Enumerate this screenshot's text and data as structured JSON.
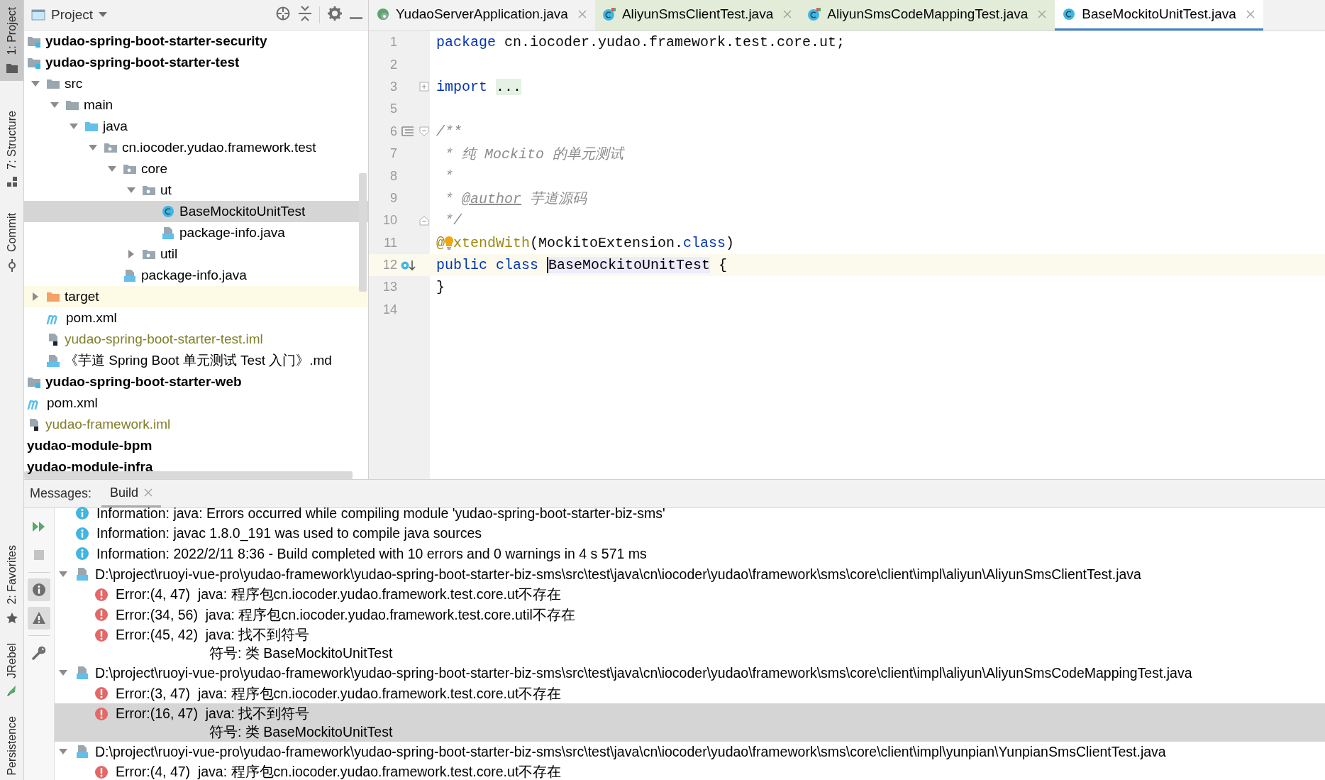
{
  "tool_strip": {
    "top": [
      {
        "label": "1: Project",
        "kind": "folder",
        "selected": true
      },
      {
        "label": "7: Structure",
        "kind": "structure",
        "selected": false
      },
      {
        "label": "Commit",
        "kind": "commit",
        "selected": false
      }
    ],
    "bottom": [
      {
        "label": "2: Favorites",
        "kind": "star",
        "selected": false
      },
      {
        "label": "JRebel",
        "kind": "jrebel",
        "selected": false
      },
      {
        "label": "Persistence",
        "kind": "none",
        "selected": false
      }
    ]
  },
  "project": {
    "title": "Project",
    "tree": [
      {
        "label": "yudao-spring-boot-starter-security",
        "kind": "module",
        "selected": false
      },
      {
        "label": "yudao-spring-boot-starter-test",
        "kind": "module",
        "selected": false,
        "children": [
          {
            "label": "src",
            "kind": "folder",
            "selected": false,
            "expanded": true,
            "children": [
              {
                "label": "main",
                "kind": "folder",
                "selected": false,
                "expanded": true,
                "children": [
                  {
                    "label": "java",
                    "kind": "source-folder",
                    "selected": false,
                    "expanded": true,
                    "children": [
                      {
                        "label": "cn.iocoder.yudao.framework.test",
                        "kind": "package",
                        "selected": false,
                        "expanded": true,
                        "children": [
                          {
                            "label": "core",
                            "kind": "package",
                            "selected": false,
                            "expanded": true,
                            "children": [
                              {
                                "label": "ut",
                                "kind": "package",
                                "selected": false,
                                "expanded": true,
                                "children": [
                                  {
                                    "label": "BaseMockitoUnitTest",
                                    "kind": "class",
                                    "selected": true
                                  },
                                  {
                                    "label": "package-info.java",
                                    "kind": "java-file",
                                    "selected": false
                                  }
                                ]
                              },
                              {
                                "label": "util",
                                "kind": "package",
                                "selected": false,
                                "expanded": false
                              }
                            ]
                          },
                          {
                            "label": "package-info.java",
                            "kind": "java-file",
                            "selected": false
                          }
                        ]
                      }
                    ]
                  }
                ]
              }
            ]
          },
          {
            "label": "target",
            "kind": "excluded-folder",
            "selected": false,
            "expanded": false
          },
          {
            "label": "pom.xml",
            "kind": "maven",
            "selected": false
          },
          {
            "label": "yudao-spring-boot-starter-test.iml",
            "kind": "iml",
            "selected": false
          },
          {
            "label": "《芋道 Spring Boot 单元测试 Test 入门》.md",
            "kind": "markdown",
            "selected": false
          }
        ]
      },
      {
        "label": "yudao-spring-boot-starter-web",
        "kind": "module",
        "selected": false
      },
      {
        "label": "pom.xml",
        "kind": "maven",
        "selected": false
      },
      {
        "label": "yudao-framework.iml",
        "kind": "iml",
        "selected": false
      },
      {
        "label": "yudao-module-bpm",
        "kind": "group",
        "selected": false
      },
      {
        "label": "yudao-module-infra",
        "kind": "group",
        "selected": false
      }
    ]
  },
  "editor": {
    "tabs": [
      {
        "label": "YudaoServerApplication.java",
        "kind": "spring-app",
        "selected": false,
        "test_scope": false
      },
      {
        "label": "AliyunSmsClientTest.java",
        "kind": "test-class",
        "selected": false,
        "test_scope": true
      },
      {
        "label": "AliyunSmsCodeMappingTest.java",
        "kind": "test-class",
        "selected": false,
        "test_scope": true
      },
      {
        "label": "BaseMockitoUnitTest.java",
        "kind": "class",
        "selected": true,
        "test_scope": false
      }
    ],
    "lines": [
      {
        "number": "1",
        "current": false,
        "tokens": [
          {
            "text": "package",
            "kind": "keyword"
          },
          {
            "text": " cn.iocoder.yudao.framework.test.core.ut;",
            "kind": "plain"
          }
        ]
      },
      {
        "number": "2",
        "current": false
      },
      {
        "number": "3",
        "current": false,
        "gutter": [
          {
            "kind": "fold-expand"
          }
        ],
        "tokens": [
          {
            "text": "import ",
            "kind": "keyword"
          },
          {
            "text": "...",
            "kind": "folded"
          }
        ]
      },
      {
        "number": "5",
        "current": false
      },
      {
        "number": "6",
        "current": false,
        "gutter": [
          {
            "kind": "doc"
          },
          {
            "kind": "fold-start"
          }
        ],
        "tokens": [
          {
            "text": "/**",
            "kind": "comment"
          }
        ]
      },
      {
        "number": "7",
        "current": false,
        "tokens": [
          {
            "text": " * 纯 Mockito 的单元测试",
            "kind": "comment"
          }
        ]
      },
      {
        "number": "8",
        "current": false,
        "tokens": [
          {
            "text": " *",
            "kind": "comment"
          }
        ]
      },
      {
        "number": "9",
        "current": false,
        "tokens": [
          {
            "text": " * ",
            "kind": "comment"
          },
          {
            "text": "@author",
            "kind": "doc-tag"
          },
          {
            "text": " 芋道源码",
            "kind": "comment"
          }
        ]
      },
      {
        "number": "10",
        "current": false,
        "gutter": [
          {
            "kind": "fold-end"
          }
        ],
        "tokens": [
          {
            "text": " */",
            "kind": "comment"
          }
        ]
      },
      {
        "number": "11",
        "current": false,
        "tokens": [
          {
            "text": "@",
            "kind": "annotation"
          },
          {
            "kind": "bulb"
          },
          {
            "text": "xtendWith",
            "kind": "annotation"
          },
          {
            "text": "(MockitoExtension.",
            "kind": "plain"
          },
          {
            "text": "class",
            "kind": "keyword"
          },
          {
            "text": ")",
            "kind": "plain"
          }
        ]
      },
      {
        "number": "12",
        "current": true,
        "gutter": [
          {
            "kind": "run"
          }
        ],
        "tokens": [
          {
            "text": "public ",
            "kind": "keyword"
          },
          {
            "text": "class ",
            "kind": "keyword"
          },
          {
            "text": "BaseMockitoUnitTest",
            "kind": "declaration"
          },
          {
            "text": " {",
            "kind": "plain"
          }
        ]
      },
      {
        "number": "13",
        "current": false,
        "tokens": [
          {
            "text": "}",
            "kind": "plain"
          }
        ]
      },
      {
        "number": "14",
        "current": false
      }
    ]
  },
  "messages": {
    "label": "Messages:",
    "tabs": [
      {
        "label": "Build",
        "selected": true
      }
    ],
    "toolbar": [
      {
        "kind": "rerun",
        "on": false
      },
      {
        "kind": "stop",
        "on": false
      },
      {
        "kind": "info",
        "on": true
      },
      {
        "kind": "warning",
        "on": true
      },
      {
        "kind": "settings",
        "on": false
      }
    ],
    "items": [
      {
        "kind": "info",
        "text": "Information: java: Errors occurred while compiling module 'yudao-spring-boot-starter-biz-sms'"
      },
      {
        "kind": "info",
        "text": "Information: javac 1.8.0_191 was used to compile java sources"
      },
      {
        "kind": "info",
        "text": "Information: 2022/2/11 8:36 - Build completed with 10 errors and 0 warnings in 4 s 571 ms"
      },
      {
        "kind": "file",
        "expanded": true,
        "text": "D:\\project\\ruoyi-vue-pro\\yudao-framework\\yudao-spring-boot-starter-biz-sms\\src\\test\\java\\cn\\iocoder\\yudao\\framework\\sms\\core\\client\\impl\\aliyun\\AliyunSmsClientTest.java",
        "children": [
          {
            "kind": "error",
            "selected": false,
            "text": "Error:(4, 47)  java: 程序包cn.iocoder.yudao.framework.test.core.ut不存在"
          },
          {
            "kind": "error",
            "selected": false,
            "text": "Error:(34, 56)  java: 程序包cn.iocoder.yudao.framework.test.core.util不存在"
          },
          {
            "kind": "error",
            "selected": false,
            "text": "Error:(45, 42)  java: 找不到符号",
            "detail": "符号: 类 BaseMockitoUnitTest"
          }
        ]
      },
      {
        "kind": "file",
        "expanded": true,
        "text": "D:\\project\\ruoyi-vue-pro\\yudao-framework\\yudao-spring-boot-starter-biz-sms\\src\\test\\java\\cn\\iocoder\\yudao\\framework\\sms\\core\\client\\impl\\aliyun\\AliyunSmsCodeMappingTest.java",
        "children": [
          {
            "kind": "error",
            "selected": false,
            "text": "Error:(3, 47)  java: 程序包cn.iocoder.yudao.framework.test.core.ut不存在"
          },
          {
            "kind": "error",
            "selected": true,
            "text": "Error:(16, 47)  java: 找不到符号",
            "detail": "符号: 类 BaseMockitoUnitTest"
          }
        ]
      },
      {
        "kind": "file",
        "expanded": true,
        "text": "D:\\project\\ruoyi-vue-pro\\yudao-framework\\yudao-spring-boot-starter-biz-sms\\src\\test\\java\\cn\\iocoder\\yudao\\framework\\sms\\core\\client\\impl\\yunpian\\YunpianSmsClientTest.java",
        "children": [
          {
            "kind": "error",
            "selected": false,
            "text": "Error:(4, 47)  java: 程序包cn.iocoder.yudao.framework.test.core.ut不存在"
          }
        ]
      }
    ]
  }
}
